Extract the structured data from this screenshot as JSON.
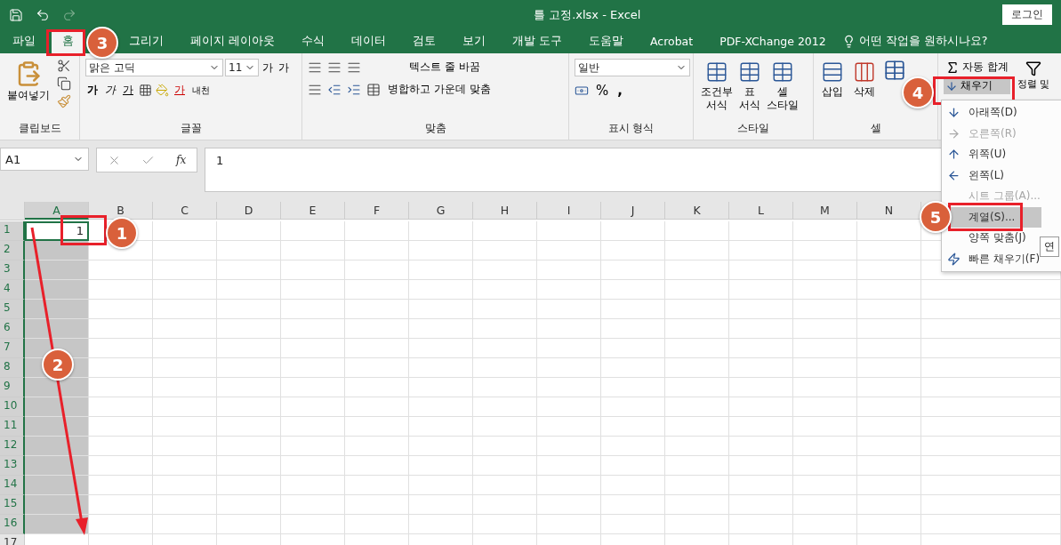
{
  "title_bar": {
    "title": "틀 고정.xlsx  -  Excel",
    "login": "로그인"
  },
  "tabs": [
    {
      "label": "파일",
      "selected": false
    },
    {
      "label": "홈",
      "selected": true
    },
    {
      "label": "그리기",
      "selected": false
    },
    {
      "label": "페이지 레이아웃",
      "selected": false
    },
    {
      "label": "수식",
      "selected": false
    },
    {
      "label": "데이터",
      "selected": false
    },
    {
      "label": "검토",
      "selected": false
    },
    {
      "label": "보기",
      "selected": false
    },
    {
      "label": "개발 도구",
      "selected": false
    },
    {
      "label": "도움말",
      "selected": false
    },
    {
      "label": "Acrobat",
      "selected": false
    },
    {
      "label": "PDF-XChange 2012",
      "selected": false
    }
  ],
  "tell_me": "어떤 작업을 원하시나요?",
  "ribbon": {
    "clipboard": {
      "label": "클립보드",
      "paste": "붙여넣기"
    },
    "font": {
      "label": "글꼴",
      "font_name": "맑은 고딕",
      "font_size": "11",
      "grow": "가",
      "shrink": "가",
      "bold": "가",
      "italic": "가",
      "underline": "가",
      "font_color": "가",
      "phonetic": "내천"
    },
    "alignment": {
      "label": "맞춤",
      "wrap": "텍스트 줄 바꿈",
      "merge": "병합하고 가운데 맞춤"
    },
    "number": {
      "label": "표시 형식",
      "format": "일반",
      "percent": "%",
      "comma": ","
    },
    "styles": {
      "label": "스타일",
      "buttons": [
        [
          "조건부",
          "서식"
        ],
        [
          "표",
          "서식"
        ],
        [
          "셀",
          "스타일"
        ]
      ]
    },
    "cells": {
      "label": "셀",
      "buttons": [
        "삽입",
        "삭제"
      ]
    },
    "editing": {
      "autosum": "자동 합계",
      "fill": "채우기",
      "sort": "정렬 및"
    }
  },
  "formula_bar": {
    "name_box": "A1",
    "fx": "fx",
    "value": "1"
  },
  "sheet": {
    "columns": [
      {
        "label": "A",
        "selected": true
      },
      {
        "label": "B",
        "selected": false
      },
      {
        "label": "C",
        "selected": false
      },
      {
        "label": "D",
        "selected": false
      },
      {
        "label": "E",
        "selected": false
      },
      {
        "label": "F",
        "selected": false
      },
      {
        "label": "G",
        "selected": false
      },
      {
        "label": "H",
        "selected": false
      },
      {
        "label": "I",
        "selected": false
      },
      {
        "label": "J",
        "selected": false
      },
      {
        "label": "K",
        "selected": false
      },
      {
        "label": "L",
        "selected": false
      },
      {
        "label": "M",
        "selected": false
      },
      {
        "label": "N",
        "selected": false
      }
    ],
    "rows": [
      {
        "label": "1",
        "selected": true
      },
      {
        "label": "2",
        "selected": true
      },
      {
        "label": "3",
        "selected": true
      },
      {
        "label": "4",
        "selected": true
      },
      {
        "label": "5",
        "selected": true
      },
      {
        "label": "6",
        "selected": true
      },
      {
        "label": "7",
        "selected": true
      },
      {
        "label": "8",
        "selected": true
      },
      {
        "label": "9",
        "selected": true
      },
      {
        "label": "10",
        "selected": true
      },
      {
        "label": "11",
        "selected": true
      },
      {
        "label": "12",
        "selected": true
      },
      {
        "label": "13",
        "selected": true
      },
      {
        "label": "14",
        "selected": true
      },
      {
        "label": "15",
        "selected": true
      },
      {
        "label": "16",
        "selected": true
      },
      {
        "label": "17",
        "selected": false
      }
    ],
    "a1": "1"
  },
  "fill_menu": [
    {
      "kind": "down",
      "label": "아래쪽(D)",
      "disabled": false,
      "highlighted": false
    },
    {
      "kind": "right",
      "label": "오른쪽(R)",
      "disabled": true,
      "highlighted": false
    },
    {
      "kind": "up",
      "label": "위쪽(U)",
      "disabled": false,
      "highlighted": false
    },
    {
      "kind": "left",
      "label": "왼쪽(L)",
      "disabled": false,
      "highlighted": false
    },
    {
      "kind": "none",
      "label": "시트 그룹(A)...",
      "disabled": true,
      "highlighted": false
    },
    {
      "kind": "none",
      "label": "계열(S)...",
      "disabled": false,
      "highlighted": true
    },
    {
      "kind": "none",
      "label": "양쪽 맞춤(J)",
      "disabled": false,
      "highlighted": false
    },
    {
      "kind": "flash",
      "label": "빠른 채우기(F)",
      "disabled": false,
      "highlighted": false
    }
  ],
  "tooltip": "연",
  "callouts": [
    "1",
    "2",
    "3",
    "4",
    "5"
  ]
}
